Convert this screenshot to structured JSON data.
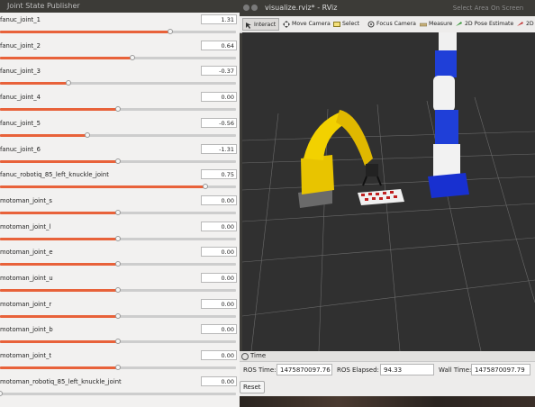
{
  "jsp": {
    "title": "Joint State Publisher",
    "joints": [
      {
        "name": "fanuc_joint_1",
        "value": "1.31",
        "fraction": 0.72
      },
      {
        "name": "fanuc_joint_2",
        "value": "0.64",
        "fraction": 0.56
      },
      {
        "name": "fanuc_joint_3",
        "value": "-0.37",
        "fraction": 0.29
      },
      {
        "name": "fanuc_joint_4",
        "value": "0.00",
        "fraction": 0.5
      },
      {
        "name": "fanuc_joint_5",
        "value": "-0.56",
        "fraction": 0.37
      },
      {
        "name": "fanuc_joint_6",
        "value": "-1.31",
        "fraction": 0.5
      },
      {
        "name": "fanuc_robotiq_85_left_knuckle_joint",
        "value": "0.75",
        "fraction": 0.87
      },
      {
        "name": "motoman_joint_s",
        "value": "0.00",
        "fraction": 0.5
      },
      {
        "name": "motoman_joint_l",
        "value": "0.00",
        "fraction": 0.5
      },
      {
        "name": "motoman_joint_e",
        "value": "0.00",
        "fraction": 0.5
      },
      {
        "name": "motoman_joint_u",
        "value": "0.00",
        "fraction": 0.5
      },
      {
        "name": "motoman_joint_r",
        "value": "0.00",
        "fraction": 0.5
      },
      {
        "name": "motoman_joint_b",
        "value": "0.00",
        "fraction": 0.5
      },
      {
        "name": "motoman_joint_t",
        "value": "0.00",
        "fraction": 0.5
      },
      {
        "name": "motoman_robotiq_85_left_knuckle_joint",
        "value": "0.00",
        "fraction": 0.0
      }
    ]
  },
  "rviz": {
    "title": "visualize.rviz* - RViz",
    "top_right": "Select Area On Screen",
    "tools": [
      {
        "label": "Interact",
        "icon": "interact-icon",
        "active": true
      },
      {
        "label": "Move Camera",
        "icon": "move-camera-icon",
        "active": false
      },
      {
        "label": "Select",
        "icon": "select-icon",
        "active": false
      },
      {
        "label": "Focus Camera",
        "icon": "focus-camera-icon",
        "active": false
      },
      {
        "label": "Measure",
        "icon": "measure-icon",
        "active": false
      },
      {
        "label": "2D Pose Estimate",
        "icon": "pose-estimate-icon",
        "active": false
      },
      {
        "label": "2D",
        "icon": "nav-goal-icon",
        "active": false
      }
    ],
    "time_panel": {
      "header": "Time",
      "ros_time_label": "ROS Time:",
      "ros_time": "1475870097.76",
      "ros_elapsed_label": "ROS Elapsed:",
      "ros_elapsed": "94.33",
      "wall_time_label": "Wall Time:",
      "wall_time": "1475870097.79",
      "reset_label": "Reset"
    }
  }
}
